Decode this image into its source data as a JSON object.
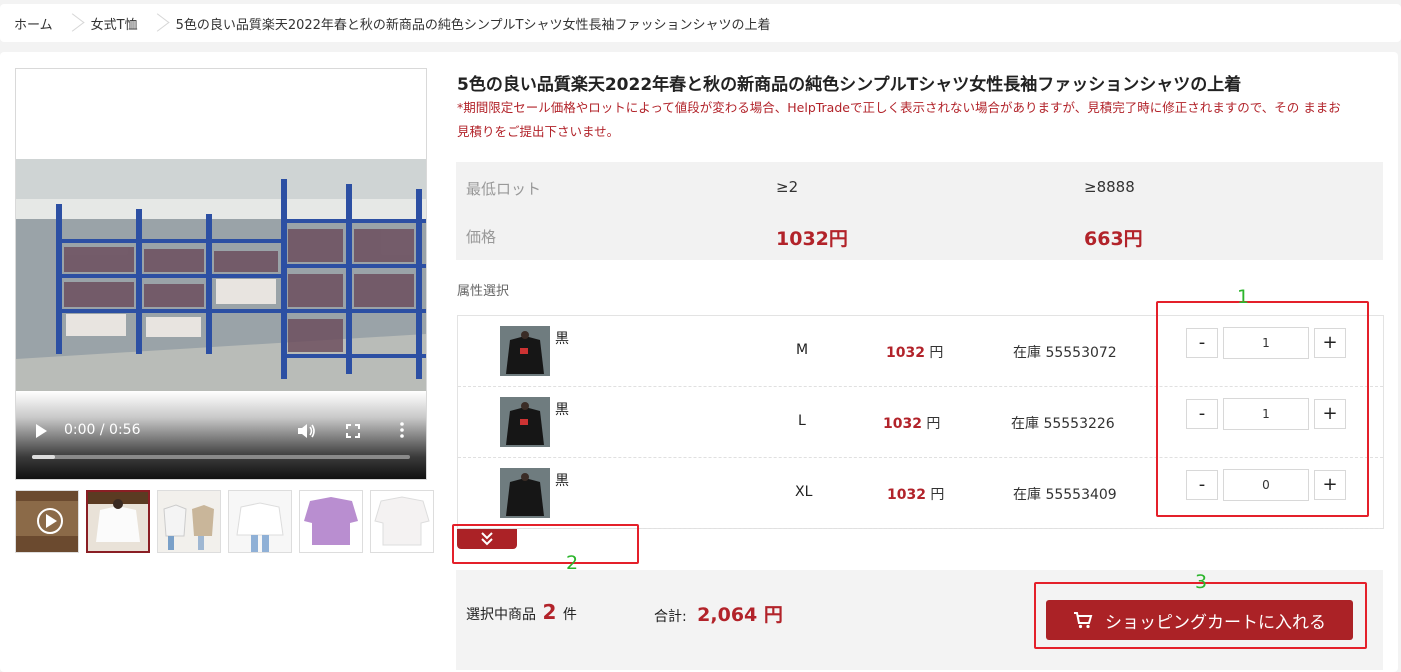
{
  "breadcrumb": [
    "ホーム",
    "女式T恤",
    "5色の良い品質楽天2022年春と秋の新商品の純色シンプルTシャツ女性長袖ファッションシャツの上着"
  ],
  "product": {
    "title": "5色の良い品質楽天2022年春と秋の新商品の純色シンプルTシャツ女性長袖ファッションシャツの上着",
    "notice_line1": "*期間限定セール価格やロットによって値段が変わる場合、HelpTradeで正しく表示されない場合がありますが、見積完了時に修正されますので、その ままお",
    "notice_line2": "見積りをご提出下さいませ。"
  },
  "video": {
    "time": "0:00 / 0:56",
    "progress": 0.06
  },
  "pricing": {
    "lot_label": "最低ロット",
    "price_label": "価格",
    "tiers": [
      {
        "lot": "≥2",
        "price": "1032円"
      },
      {
        "lot": "≥8888",
        "price": "663円"
      }
    ]
  },
  "attributes": {
    "title": "属性選択",
    "rows": [
      {
        "color": "黒",
        "size": "M",
        "price": "1032",
        "unit": "円",
        "stock": "在庫 55553072",
        "qty": "1"
      },
      {
        "color": "黒",
        "size": "L",
        "price": "1032",
        "unit": "円",
        "stock": "在庫 55553226",
        "qty": "1"
      },
      {
        "color": "黒",
        "size": "XL",
        "price": "1032",
        "unit": "円",
        "stock": "在庫 55553409",
        "qty": "0"
      }
    ],
    "minus": "-",
    "plus": "+"
  },
  "footer": {
    "selected_prefix": "選択中商品",
    "selected_count": "2",
    "selected_suffix": "件",
    "total_label": "合計:",
    "total_value": "2,064 円",
    "cart_button": "ショッピングカートに入れる"
  },
  "annotations": [
    "1",
    "2",
    "3"
  ],
  "colors": {
    "accent": "#ab2226",
    "price_red": "#b2232a",
    "annotation_red": "#e4202a",
    "annotation_green": "#2cb52c"
  }
}
